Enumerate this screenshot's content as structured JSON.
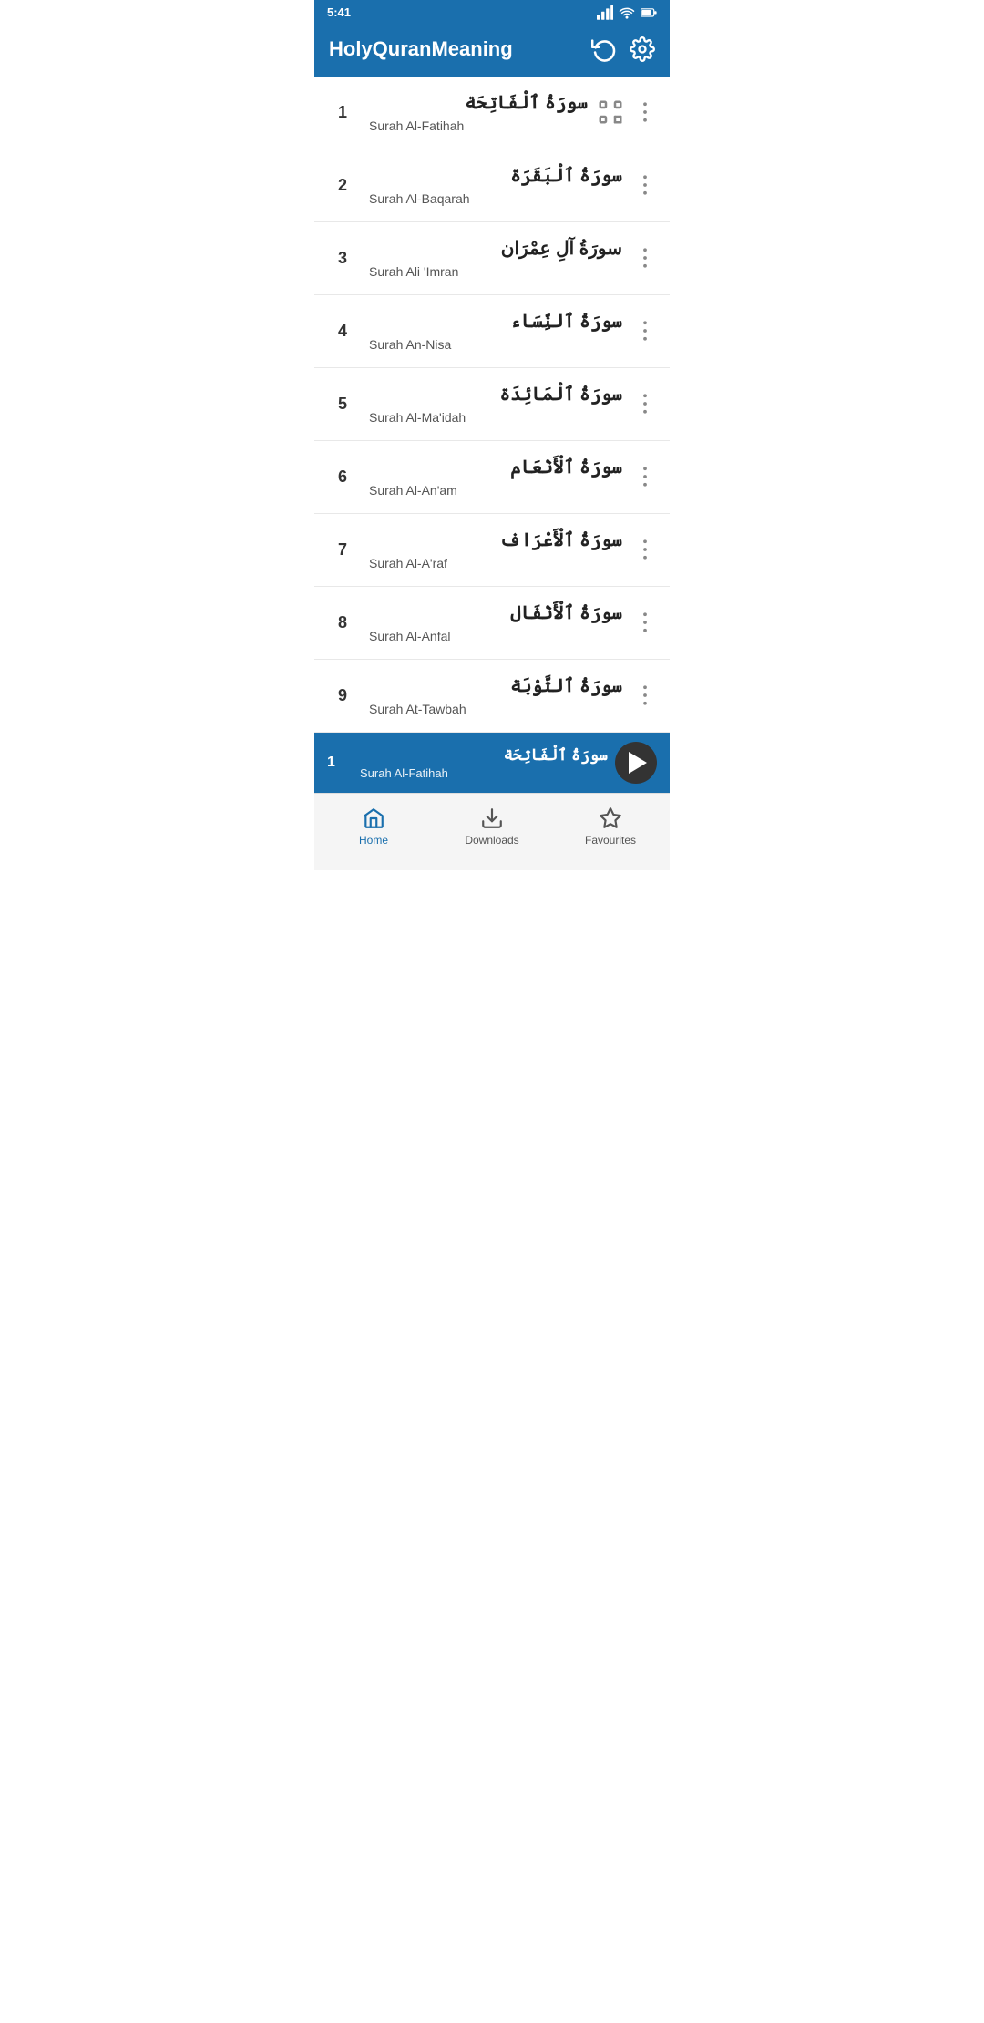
{
  "app": {
    "title": "HolyQuranMeaning"
  },
  "status_bar": {
    "time": "5:41",
    "icons": [
      "signal",
      "wifi",
      "battery"
    ]
  },
  "header": {
    "update_icon": "update-icon",
    "settings_icon": "settings-icon"
  },
  "surahs": [
    {
      "number": 1,
      "arabic": "سورَةُ ٱلْفَاتِحَة",
      "english": "Surah Al-Fatihah",
      "has_scan": true
    },
    {
      "number": 2,
      "arabic": "سورَةُ ٱلْبَقَرَة",
      "english": "Surah Al-Baqarah",
      "has_scan": false
    },
    {
      "number": 3,
      "arabic": "سورَةُ آلِ عِمْرَان",
      "english": "Surah Ali 'Imran",
      "has_scan": false
    },
    {
      "number": 4,
      "arabic": "سورَةُ ٱلنِّسَاء",
      "english": "Surah An-Nisa",
      "has_scan": false
    },
    {
      "number": 5,
      "arabic": "سورَةُ ٱلْمَائِدَة",
      "english": "Surah Al-Ma'idah",
      "has_scan": false
    },
    {
      "number": 6,
      "arabic": "سورَةُ ٱلْأَنْعَام",
      "english": "Surah Al-An'am",
      "has_scan": false
    },
    {
      "number": 7,
      "arabic": "سورَةُ ٱلْأَعْرَاف",
      "english": "Surah Al-A'raf",
      "has_scan": false
    },
    {
      "number": 8,
      "arabic": "سورَةُ ٱلْأَنْفَال",
      "english": "Surah Al-Anfal",
      "has_scan": false
    },
    {
      "number": 9,
      "arabic": "سورَةُ ٱلتَّوْبَة",
      "english": "Surah At-Tawbah",
      "has_scan": false
    }
  ],
  "now_playing": {
    "number": 1,
    "arabic": "سورَةُ ٱلْفَاتِحَة",
    "english": "Surah Al-Fatihah"
  },
  "nav": {
    "items": [
      {
        "key": "home",
        "label": "Home",
        "active": true
      },
      {
        "key": "downloads",
        "label": "Downloads",
        "active": false
      },
      {
        "key": "favourites",
        "label": "Favourites",
        "active": false
      }
    ]
  },
  "colors": {
    "primary": "#1a6fad",
    "background": "#ffffff",
    "text_dark": "#222222",
    "text_medium": "#555555",
    "text_light": "#888888",
    "border": "#e8e8e8"
  }
}
